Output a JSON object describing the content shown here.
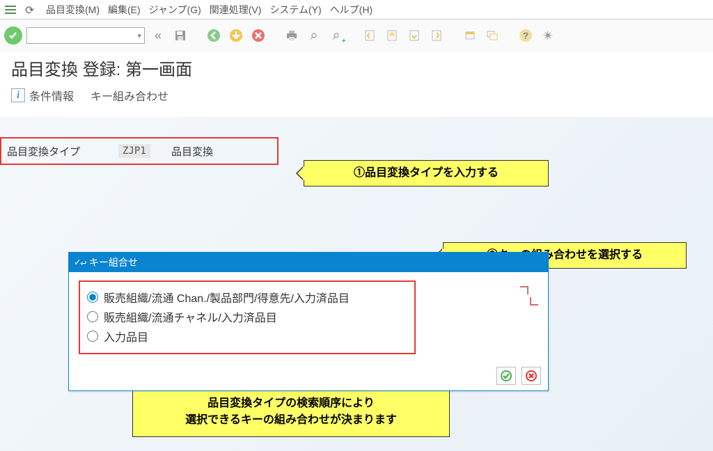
{
  "menubar": {
    "items": [
      "品目変換(M)",
      "編集(E)",
      "ジャンプ(G)",
      "関連処理(V)",
      "システム(Y)",
      "ヘルプ(H)"
    ]
  },
  "page": {
    "title": "品目変換 登録: 第一画面"
  },
  "sub_toolbar": {
    "condition_info": "条件情報",
    "key_combo": "キー組み合わせ"
  },
  "form": {
    "label": "品目変換タイプ",
    "value": "ZJP1",
    "desc": "品目変換"
  },
  "callouts": {
    "c1": "①品目変換タイプを入力する",
    "c2": "②キーの組み合わせを選択する",
    "c3_line1": "品目変換タイプの検索順序により",
    "c3_line2": "選択できるキーの組み合わせが決まります"
  },
  "popup": {
    "title": "キー組合せ",
    "options": [
      "販売組織/流通 Chan./製品部門/得意先/入力済品目",
      "販売組織/流通チャネル/入力済品目",
      "入力品目"
    ],
    "selected_index": 0
  }
}
